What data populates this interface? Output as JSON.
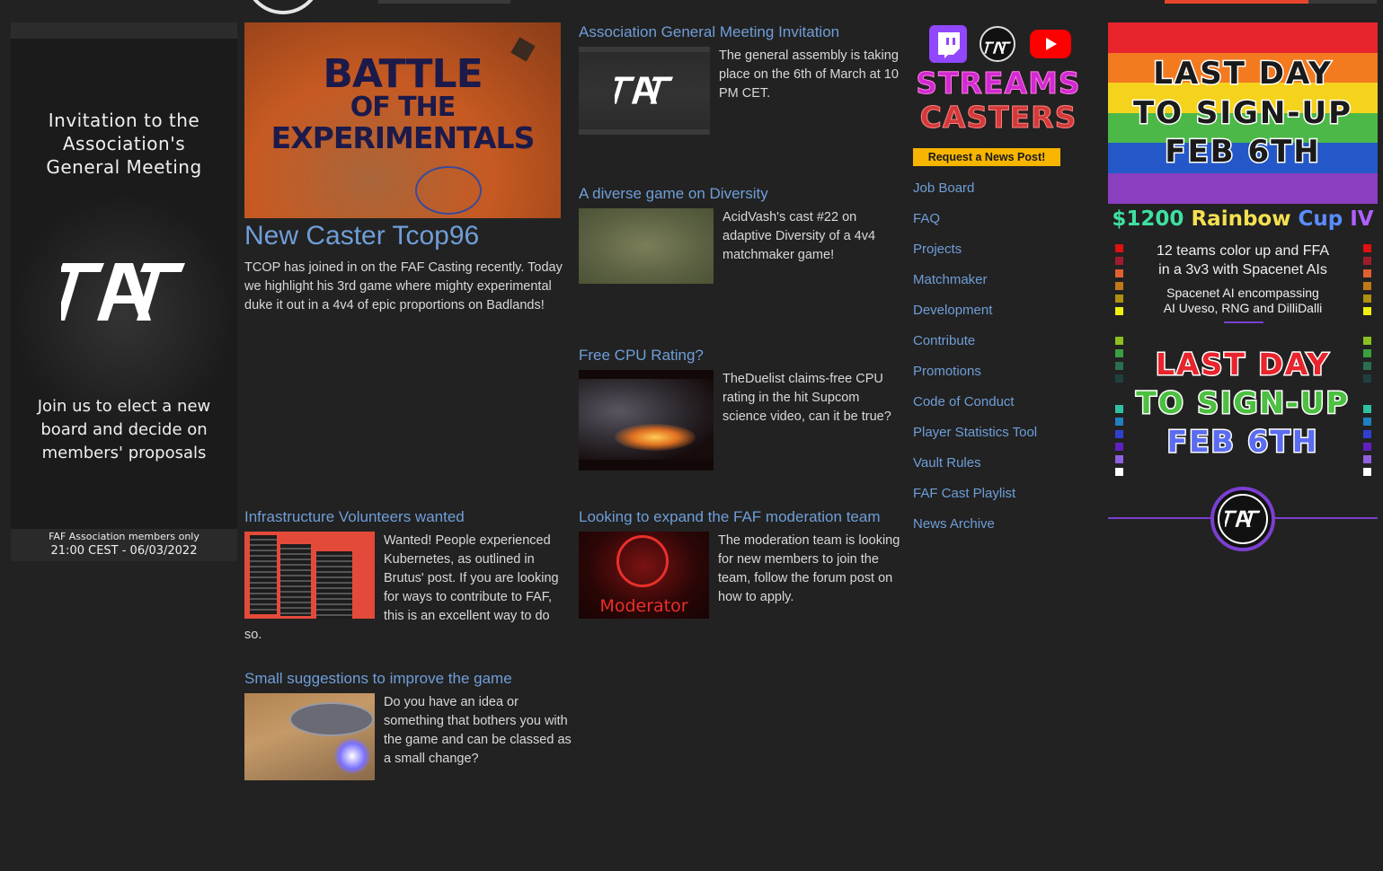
{
  "left_promo": {
    "title_lines": [
      "Invitation to the",
      "Association's",
      "General Meeting"
    ],
    "body_lines": [
      "Join us to elect a new",
      "board and decide on",
      "members' proposals"
    ],
    "footer_line1": "FAF Association members only",
    "footer_line2": "21:00 CEST - 06/03/2022"
  },
  "featured": {
    "image_lines": [
      "BATTLE",
      "OF THE",
      "EXPERIMENTALS"
    ],
    "title": "New Caster Tcop96",
    "text": "TCOP has joined in on the FAF Casting recently. Today we highlight his 3rd game where mighty experimental duke it out in a 4v4 of epic proportions on Badlands!"
  },
  "articles": [
    {
      "title": "Association General Meeting Invitation",
      "text": "The general assembly is taking place on the 6th of March at 10 PM CET."
    },
    {
      "title": "A diverse game on Diversity",
      "text": "AcidVash's cast #22 on adaptive Diversity of a 4v4 matchmaker game!"
    },
    {
      "title": "Free CPU Rating?",
      "text": "TheDuelist claims-free CPU rating in the hit Supcom science video, can it be true?"
    },
    {
      "title": "Infrastructure Volunteers wanted",
      "text": "Wanted! People experienced Kubernetes, as outlined in Brutus' post. If you are looking for ways to contribute to FAF, this is an excellent way to do so."
    },
    {
      "title": "Looking to expand the FAF moderation team",
      "text": "The moderation team is looking for new members to join the team, follow the forum post on how to apply.",
      "image_label": "Moderator"
    },
    {
      "title": "Small suggestions to improve the game",
      "text": "Do you have an idea or something that bothers you with the game and can be classed as a small change?"
    }
  ],
  "streams": {
    "line1": "STREAMS",
    "line2": "CASTERS",
    "news_button": "Request a News Post!"
  },
  "nav": [
    "Job Board",
    "FAQ",
    "Projects",
    "Matchmaker",
    "Development",
    "Contribute",
    "Promotions",
    "Code of Conduct",
    "Player Statistics Tool",
    "Vault Rules",
    "FAF Cast Playlist",
    "News Archive"
  ],
  "tournament": {
    "banner_lines": [
      "LAST DAY",
      "TO SIGN-UP",
      "FEB 6TH"
    ],
    "title_parts": [
      "$1200",
      " Rainbow",
      " Cup",
      " IV"
    ],
    "sub1_lines": [
      "12 teams color up and FFA",
      "in a 3v3 with Spacenet AIs"
    ],
    "sub2_lines": [
      "Spacenet AI encompassing",
      "AI Uveso, RNG and DilliDalli"
    ],
    "big_lines": [
      "LAST DAY",
      "TO SIGN-UP",
      "FEB 6TH"
    ]
  },
  "colors": {
    "background": "#222222",
    "link": "#6f9ed8",
    "news_button": "#f7b500",
    "accent_red": "#e8462b",
    "purple_ring": "#7a3fd0"
  }
}
